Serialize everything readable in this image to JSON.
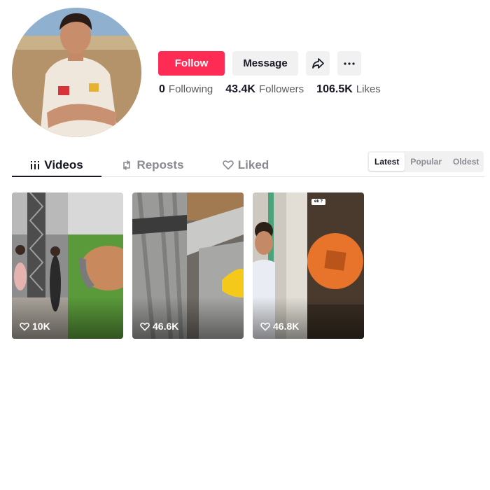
{
  "profile": {
    "follow_label": "Follow",
    "message_label": "Message",
    "stats": [
      {
        "value": "0",
        "label": "Following"
      },
      {
        "value": "43.4K",
        "label": "Followers"
      },
      {
        "value": "106.5K",
        "label": "Likes"
      }
    ]
  },
  "tabs": {
    "videos": "Videos",
    "reposts": "Reposts",
    "liked": "Liked"
  },
  "sort": {
    "options": [
      "Latest",
      "Popular",
      "Oldest"
    ],
    "active": "Latest"
  },
  "videos": [
    {
      "views": "10K"
    },
    {
      "views": "46.6K"
    },
    {
      "views": "46.8K",
      "sticker": "ek ?"
    }
  ],
  "icons": {
    "share": "share-arrow-icon",
    "more": "more-dots-icon",
    "videos_tab": "grid-bars-icon",
    "reposts_tab": "repost-icon",
    "liked_tab": "heart-outline-icon",
    "views": "heart-outline-icon"
  },
  "colors": {
    "accent": "#fe2c55",
    "text": "#161823",
    "muted": "#8a8b91",
    "button_bg": "#f1f1f2"
  }
}
